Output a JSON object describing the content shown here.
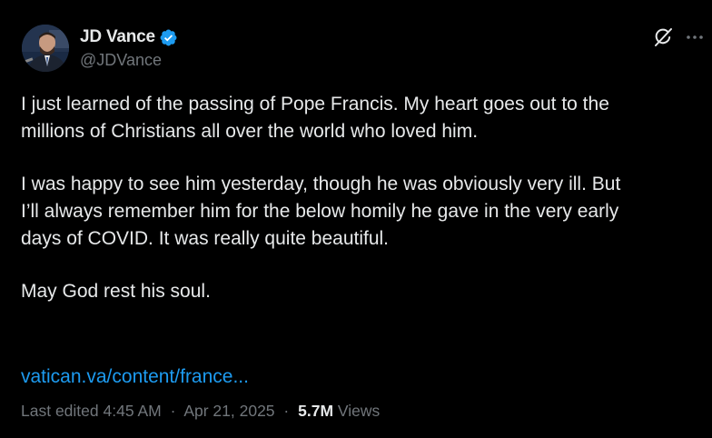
{
  "author": {
    "display_name": "JD Vance",
    "handle": "@JDVance",
    "verified_color": "#1d9bf0"
  },
  "icons": {
    "grok": "grok-icon",
    "more": "more-icon"
  },
  "post": {
    "paragraphs": [
      "I just learned of the passing of Pope Francis. My heart goes out to the\nmillions of Christians all over the world who loved him.",
      "I was happy to see him yesterday, though he was obviously very ill. But\nI’ll always remember him for the below homily he gave in the very early\ndays of COVID. It was really quite beautiful.",
      "May God rest his soul."
    ],
    "link_text": "vatican.va/content/france...",
    "link_color": "#1d9bf0"
  },
  "meta": {
    "edited_label": "Last edited",
    "time": "4:45 AM",
    "separator": "·",
    "date": "Apr 21, 2025",
    "views_count": "5.7M",
    "views_label": "Views"
  }
}
